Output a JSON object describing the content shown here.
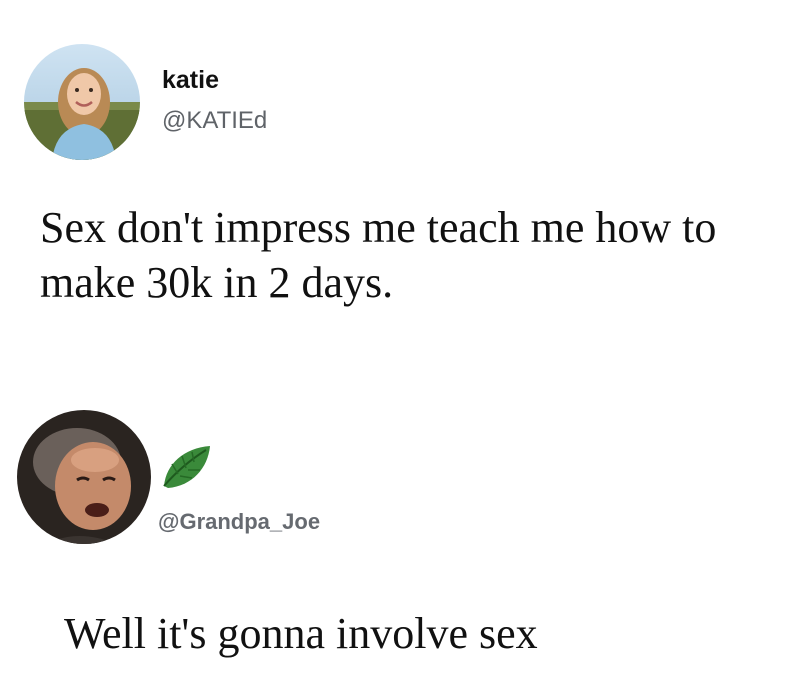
{
  "tweets": [
    {
      "display_name": "katie",
      "handle": "@KATIEd",
      "text": "Sex don't impress me teach me how to make 30k in 2 days."
    },
    {
      "display_name": "",
      "handle": "@Grandpa_Joe",
      "badge_icon": "leaf-icon",
      "text": "Well it's gonna involve sex"
    }
  ],
  "colors": {
    "background": "#ffffff",
    "text": "#111111",
    "handle": "#5f6368",
    "leaf": "#3a8a3a"
  }
}
